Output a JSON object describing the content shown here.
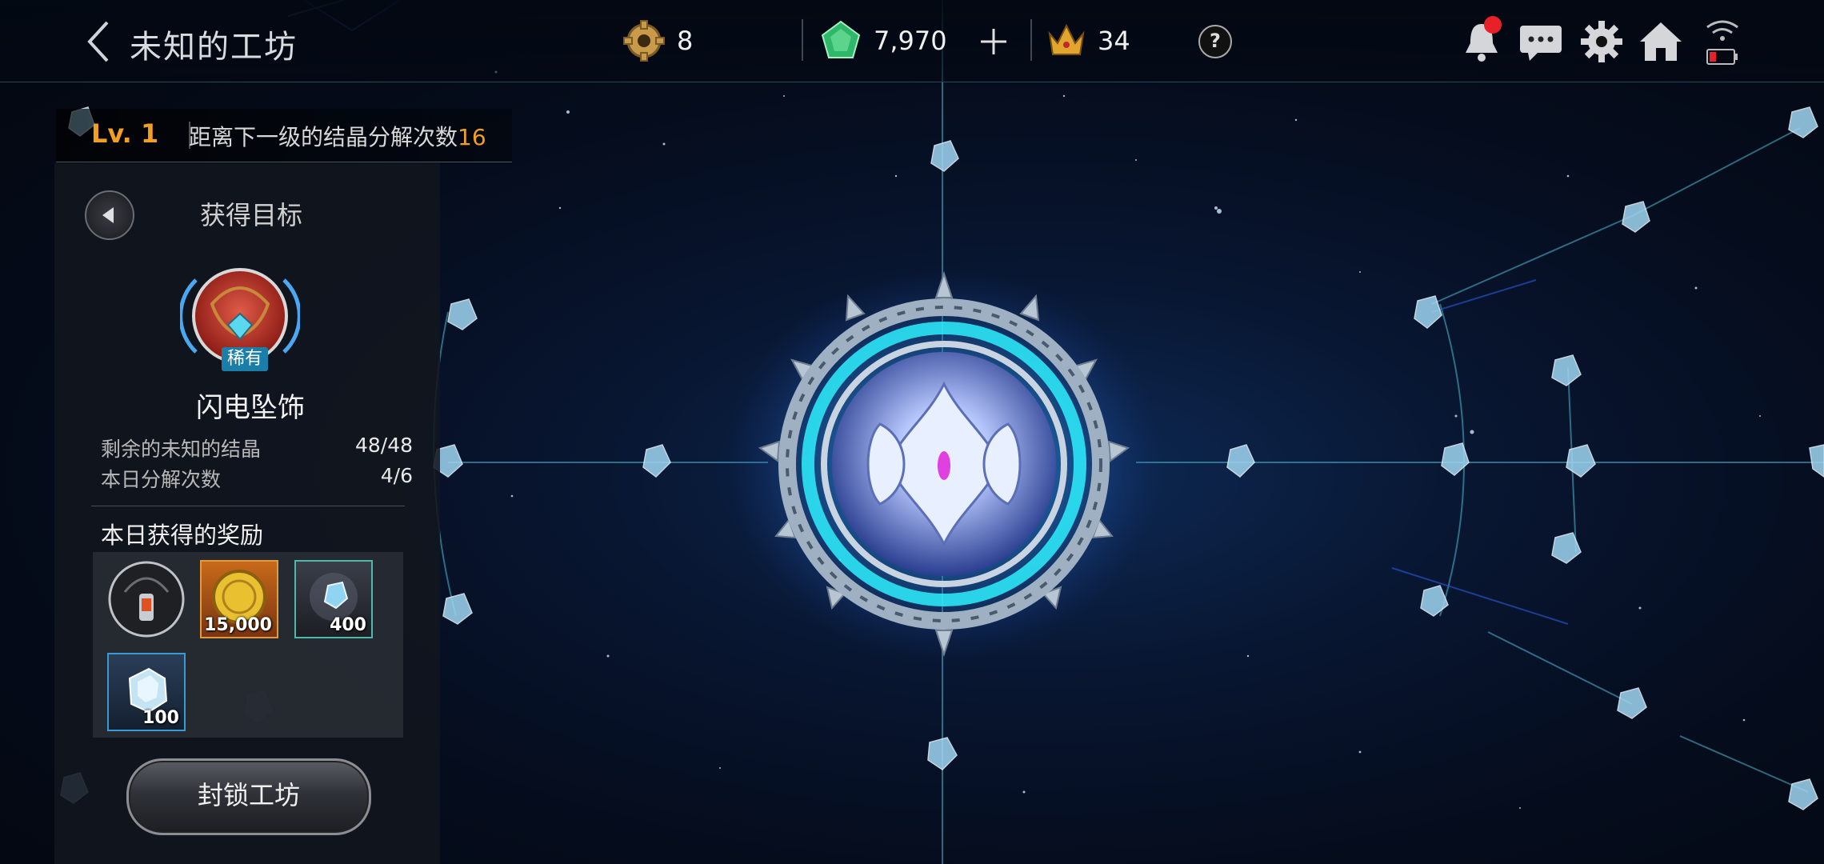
{
  "header": {
    "title": "未知的工坊",
    "resources": [
      {
        "name": "gear",
        "value": "8"
      },
      {
        "name": "crystal",
        "value": "7,970"
      },
      {
        "name": "crown",
        "value": "34"
      }
    ],
    "help_label": "?",
    "icons": [
      "bell-icon",
      "chat-icon",
      "gear-icon",
      "home-icon",
      "wifi-icon"
    ]
  },
  "level": {
    "label": "Lv. 1",
    "next_text": "距离下一级的结晶分解次数",
    "next_value": "16"
  },
  "target": {
    "title": "获得目标",
    "rarity": "稀有",
    "item_name": "闪电坠饰",
    "stats": [
      {
        "label": "剩余的未知的结晶",
        "value": "48/48"
      },
      {
        "label": "本日分解次数",
        "value": "4/6"
      }
    ]
  },
  "rewards": {
    "title": "本日获得的奖励",
    "items": [
      {
        "icon": "pendant-icon",
        "count": ""
      },
      {
        "icon": "gold-coin-icon",
        "count": "15,000"
      },
      {
        "icon": "crystal-shard-icon",
        "count": "400"
      },
      {
        "icon": "ice-crystal-icon",
        "count": "100"
      }
    ]
  },
  "lock_button": "封锁工坊",
  "colors": {
    "accent": "#f0a020",
    "rarity": "#1a7ea8",
    "notify": "#e8202a"
  }
}
